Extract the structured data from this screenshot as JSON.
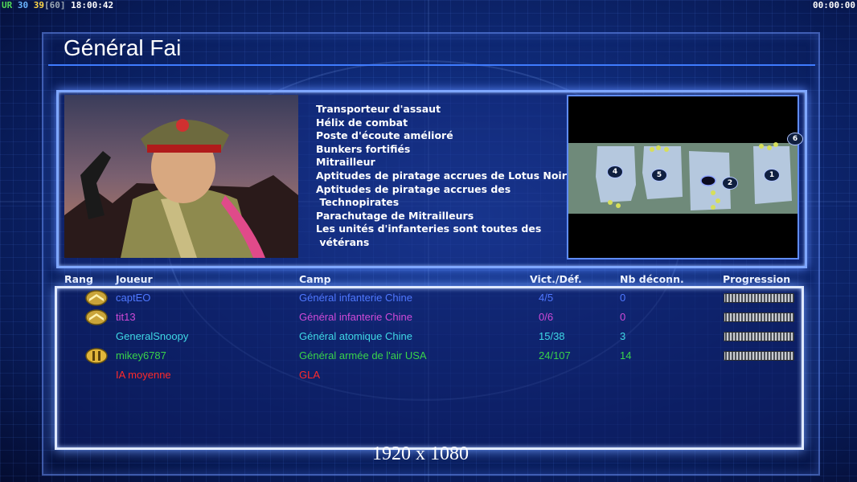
{
  "hud": {
    "left": {
      "ur": "UR",
      "fps": "30",
      "fps2": "39",
      "fps_cap": "[60]",
      "clock": "18:00:42"
    },
    "right": {
      "game_time": "00:00:00"
    }
  },
  "general": {
    "name": "Général Fai",
    "abilities": [
      "Transporteur d'assaut",
      "Hélix de combat",
      "Poste d'écoute amélioré",
      "Bunkers fortifiés",
      "Mitrailleur",
      "Aptitudes de piratage accrues de Lotus Noir",
      "Aptitudes de piratage accrues des",
      " Technopirates",
      "Parachutage de Mitrailleurs",
      "Les unités d'infanteries sont toutes des",
      " vétérans"
    ]
  },
  "minimap": {
    "start_positions": [
      "6",
      "4",
      "5",
      "2",
      "1"
    ]
  },
  "table": {
    "headers": {
      "rank": "Rang",
      "player": "Joueur",
      "faction": "Camp",
      "winloss": "Vict./Déf.",
      "disconnects": "Nb déconn.",
      "progress": "Progression"
    },
    "rows": [
      {
        "rank_icon": "chevron-rank-icon",
        "player": "captEO",
        "faction": "Général infanterie Chine",
        "winloss": "4/5",
        "disconnects": "0",
        "color": "#4f78ff",
        "progress": 1.0
      },
      {
        "rank_icon": "chevron-rank-icon",
        "player": "tit13",
        "faction": "Général infanterie Chine",
        "winloss": "0/6",
        "disconnects": "0",
        "color": "#d04ad8",
        "progress": 1.0
      },
      {
        "rank_icon": "",
        "player": "GeneralSnoopy",
        "faction": "Général atomique Chine",
        "winloss": "15/38",
        "disconnects": "3",
        "color": "#3fd8e6",
        "progress": 1.0
      },
      {
        "rank_icon": "bars-rank-icon",
        "player": "mikey6787",
        "faction": "Général armée de l'air USA",
        "winloss": "24/107",
        "disconnects": "14",
        "color": "#39d34a",
        "progress": 1.0
      },
      {
        "rank_icon": "",
        "player": "IA moyenne",
        "faction": "GLA",
        "winloss": "",
        "disconnects": "",
        "color": "#ff2a2a",
        "progress": null
      }
    ]
  },
  "footer": {
    "resolution": "1920 x 1080"
  },
  "colors": {
    "accent": "#3f7cff",
    "panel_glow": "#6f9cff"
  }
}
